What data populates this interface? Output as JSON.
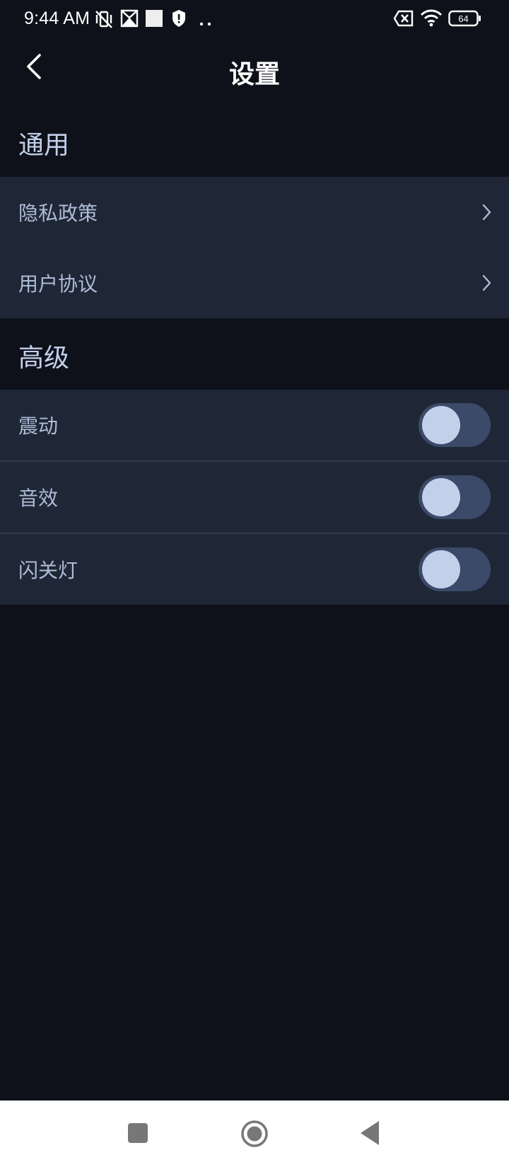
{
  "status_bar": {
    "time": "9:44 AM",
    "battery": "64",
    "icons": [
      "vibrate-off-icon",
      "notification-app-icon",
      "square-app-icon",
      "shield-alert-icon",
      "more-dots-icon",
      "data-off-icon",
      "wifi-icon",
      "battery-icon"
    ]
  },
  "header": {
    "title": "设置",
    "back_icon": "back-arrow-icon"
  },
  "sections": {
    "general": {
      "title": "通用",
      "items": [
        {
          "label": "隐私政策",
          "icon": "chevron-right-icon"
        },
        {
          "label": "用户协议",
          "icon": "chevron-right-icon"
        }
      ]
    },
    "advanced": {
      "title": "高级",
      "items": [
        {
          "label": "震动",
          "toggle": "off"
        },
        {
          "label": "音效",
          "toggle": "off"
        },
        {
          "label": "闪关灯",
          "toggle": "off"
        }
      ]
    }
  },
  "nav_bar": {
    "icons": [
      "recent-apps-icon",
      "home-icon",
      "back-icon"
    ]
  },
  "colors": {
    "background": "#0e111a",
    "group_background": "#1f2736",
    "section_title": "#c3d0ea",
    "row_label": "#aebbd6",
    "toggle_track": "#3a4a68",
    "toggle_knob": "#c2d0ea"
  }
}
